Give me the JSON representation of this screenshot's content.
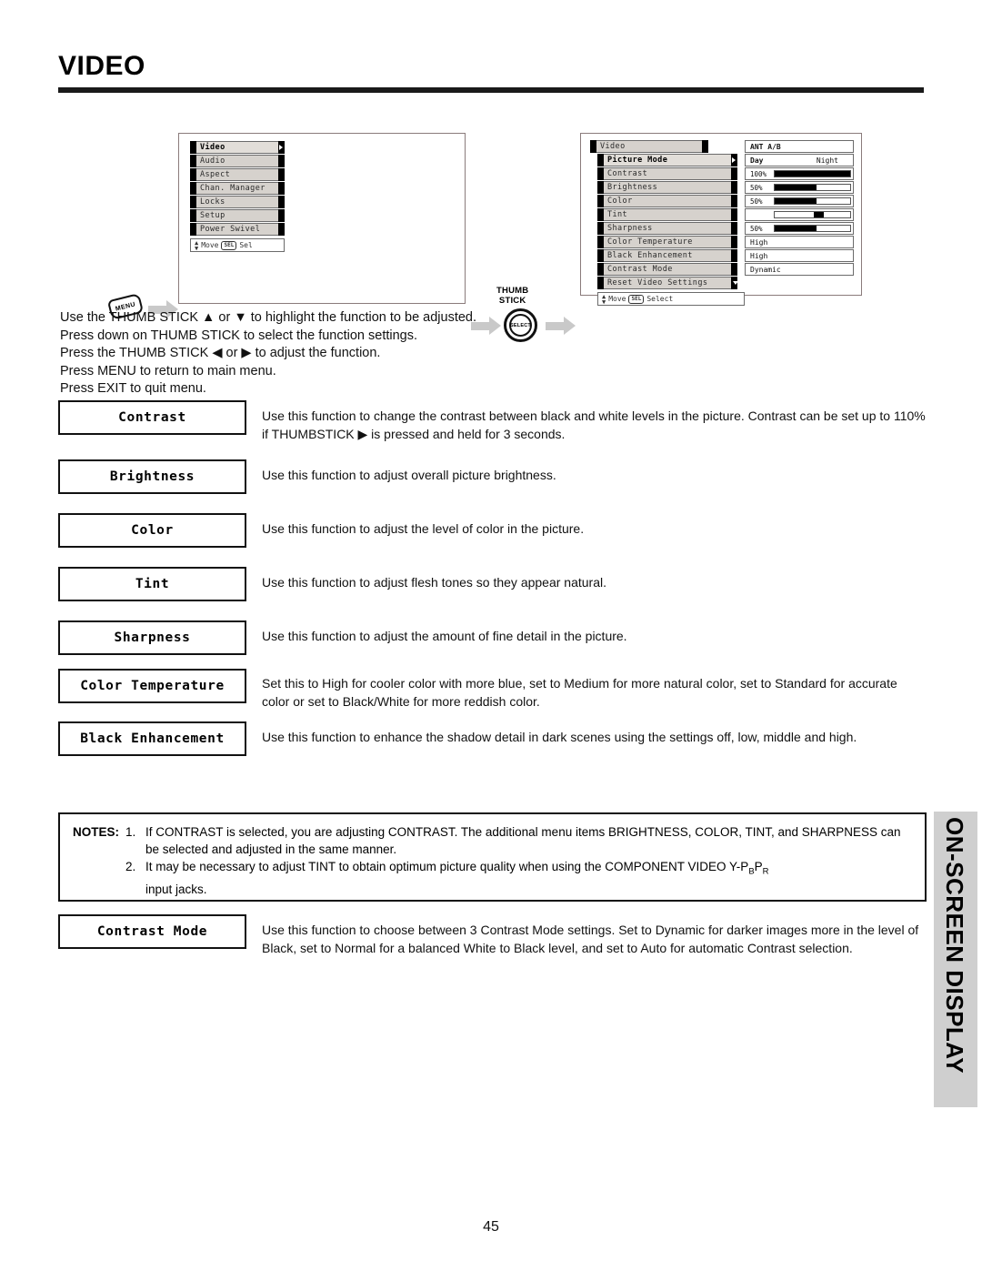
{
  "page": {
    "title": "VIDEO",
    "number": "45",
    "side_tab": "ON-SCREEN DISPLAY"
  },
  "diagram": {
    "menu_key_label": "MENU",
    "thumbstick_label_line1": "THUMB",
    "thumbstick_label_line2": "STICK",
    "select_label": "SELECT",
    "left_screen": {
      "items": [
        {
          "label": "Video",
          "selected": true,
          "arrow": "right"
        },
        {
          "label": "Audio",
          "selected": false,
          "arrow": "none"
        },
        {
          "label": "Aspect",
          "selected": false,
          "arrow": "none"
        },
        {
          "label": "Chan. Manager",
          "selected": false,
          "arrow": "none"
        },
        {
          "label": "Locks",
          "selected": false,
          "arrow": "none"
        },
        {
          "label": "Setup",
          "selected": false,
          "arrow": "none"
        },
        {
          "label": "Power Swivel",
          "selected": false,
          "arrow": "none"
        }
      ],
      "hint_move": "Move",
      "hint_key": "SEL",
      "hint_action": "Sel"
    },
    "right_screen": {
      "header": {
        "label": "Video",
        "value": "ANT A/B"
      },
      "rows": [
        {
          "label": "Picture Mode",
          "selected": true,
          "arrow": "right",
          "value_type": "text",
          "value": "Day",
          "value2": "Night"
        },
        {
          "label": "Contrast",
          "selected": false,
          "arrow": "none",
          "value_type": "meter",
          "percent_label": "100%",
          "fill": 100
        },
        {
          "label": "Brightness",
          "selected": false,
          "arrow": "none",
          "value_type": "meter",
          "percent_label": "50%",
          "fill": 55
        },
        {
          "label": "Color",
          "selected": false,
          "arrow": "none",
          "value_type": "meter",
          "percent_label": "50%",
          "fill": 55
        },
        {
          "label": "Tint",
          "selected": false,
          "arrow": "none",
          "value_type": "centermeter",
          "percent_label": "",
          "fill": 55
        },
        {
          "label": "Sharpness",
          "selected": false,
          "arrow": "none",
          "value_type": "meter",
          "percent_label": "50%",
          "fill": 55
        },
        {
          "label": "Color Temperature",
          "selected": false,
          "arrow": "none",
          "value_type": "text",
          "value": "High"
        },
        {
          "label": "Black Enhancement",
          "selected": false,
          "arrow": "none",
          "value_type": "text",
          "value": "High"
        },
        {
          "label": "Contrast Mode",
          "selected": false,
          "arrow": "none",
          "value_type": "text",
          "value": "Dynamic"
        },
        {
          "label": "Reset Video Settings",
          "selected": false,
          "arrow": "down",
          "value_type": "none"
        }
      ],
      "hint_move": "Move",
      "hint_key": "SEL",
      "hint_action": "Select"
    }
  },
  "instructions": [
    "Use the THUMB STICK ▲ or ▼ to highlight the function to be adjusted.",
    "Press down on THUMB STICK to select the function settings.",
    "Press the THUMB STICK ◀ or ▶ to adjust the function.",
    "Press MENU to return to main menu.",
    "Press EXIT to quit menu."
  ],
  "functions": [
    {
      "label": "Contrast",
      "description": "Use this function to change the contrast between black and white levels in the picture.   Contrast can be set up to 110% if THUMBSTICK ▶ is pressed and held for 3 seconds."
    },
    {
      "label": "Brightness",
      "description": "Use this function to adjust overall picture brightness."
    },
    {
      "label": "Color",
      "description": "Use this function to adjust the level of color in the picture."
    },
    {
      "label": "Tint",
      "description": "Use this function to adjust flesh tones so they appear natural."
    },
    {
      "label": "Sharpness",
      "description": "Use this function to adjust the amount of fine detail in the picture."
    },
    {
      "label": "Color Temperature",
      "description": "Set this to High for cooler color with more blue, set to Medium for more natural color, set to Standard for accurate color or set to Black/White for more reddish color."
    },
    {
      "label": "Black Enhancement",
      "description": "Use this function to enhance the shadow detail in dark scenes using the settings off, low, middle and high."
    }
  ],
  "notes": {
    "label": "NOTES:",
    "item1_num": "1.",
    "item1_text": "If CONTRAST is selected, you are adjusting CONTRAST.  The additional menu items BRIGHTNESS, COLOR, TINT, and SHARPNESS can be selected and adjusted in the same manner.",
    "item2_num": "2.",
    "item2_text_a": "It may be necessary to adjust TINT to obtain optimum picture quality when using the COMPONENT VIDEO Y-P",
    "item2_sub_b": "B",
    "item2_text_b": "P",
    "item2_sub_r": "R",
    "item2_text_c": "input jacks."
  },
  "contrast_mode": {
    "label": "Contrast Mode",
    "description": "Use this function to choose between 3 Contrast Mode settings.  Set to Dynamic for darker images more in the level of Black, set to Normal for a balanced White to Black level, and set to Auto for automatic Contrast selection."
  }
}
